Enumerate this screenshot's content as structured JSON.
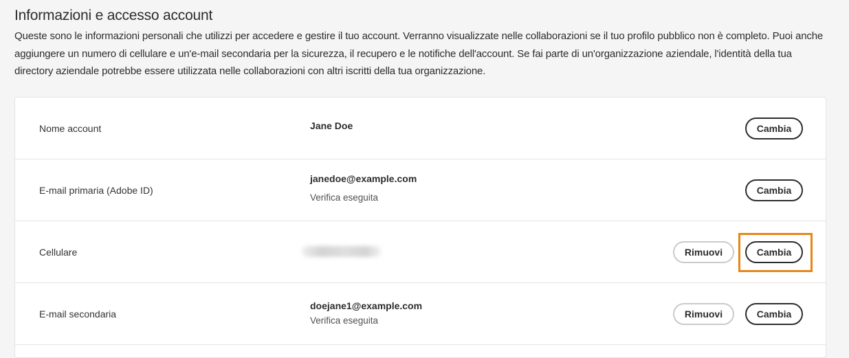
{
  "section": {
    "title": "Informazioni e accesso account",
    "description": "Queste sono le informazioni personali che utilizzi per accedere e gestire il tuo account. Verranno visualizzate nelle collaborazioni se il tuo profilo pubblico non è completo. Puoi anche aggiungere un numero di cellulare e un'e-mail secondaria per la sicurezza, il recupero e le notifiche dell'account. Se fai parte di un'organizzazione aziendale, l'identità della tua directory aziendale potrebbe essere utilizzata nelle collaborazioni con altri iscritti della tua organizzazione."
  },
  "rows": [
    {
      "label": "Nome account",
      "value": "Jane Doe",
      "change_label": "Cambia"
    },
    {
      "label": "E-mail primaria (Adobe ID)",
      "value": "janedoe@example.com",
      "status": "Verifica eseguita",
      "change_label": "Cambia"
    },
    {
      "label": "Cellulare",
      "value_redacted": true,
      "remove_label": "Rimuovi",
      "change_label": "Cambia",
      "highlighted": true
    },
    {
      "label": "E-mail secondaria",
      "value": "doejane1@example.com",
      "status": "Verifica eseguita",
      "remove_label": "Rimuovi",
      "change_label": "Cambia"
    }
  ],
  "colors": {
    "page_background": "#f5f5f5",
    "card_background": "#ffffff",
    "text": "#2c2c2c",
    "divider": "#e4e4e4",
    "highlight": "#e68619"
  }
}
